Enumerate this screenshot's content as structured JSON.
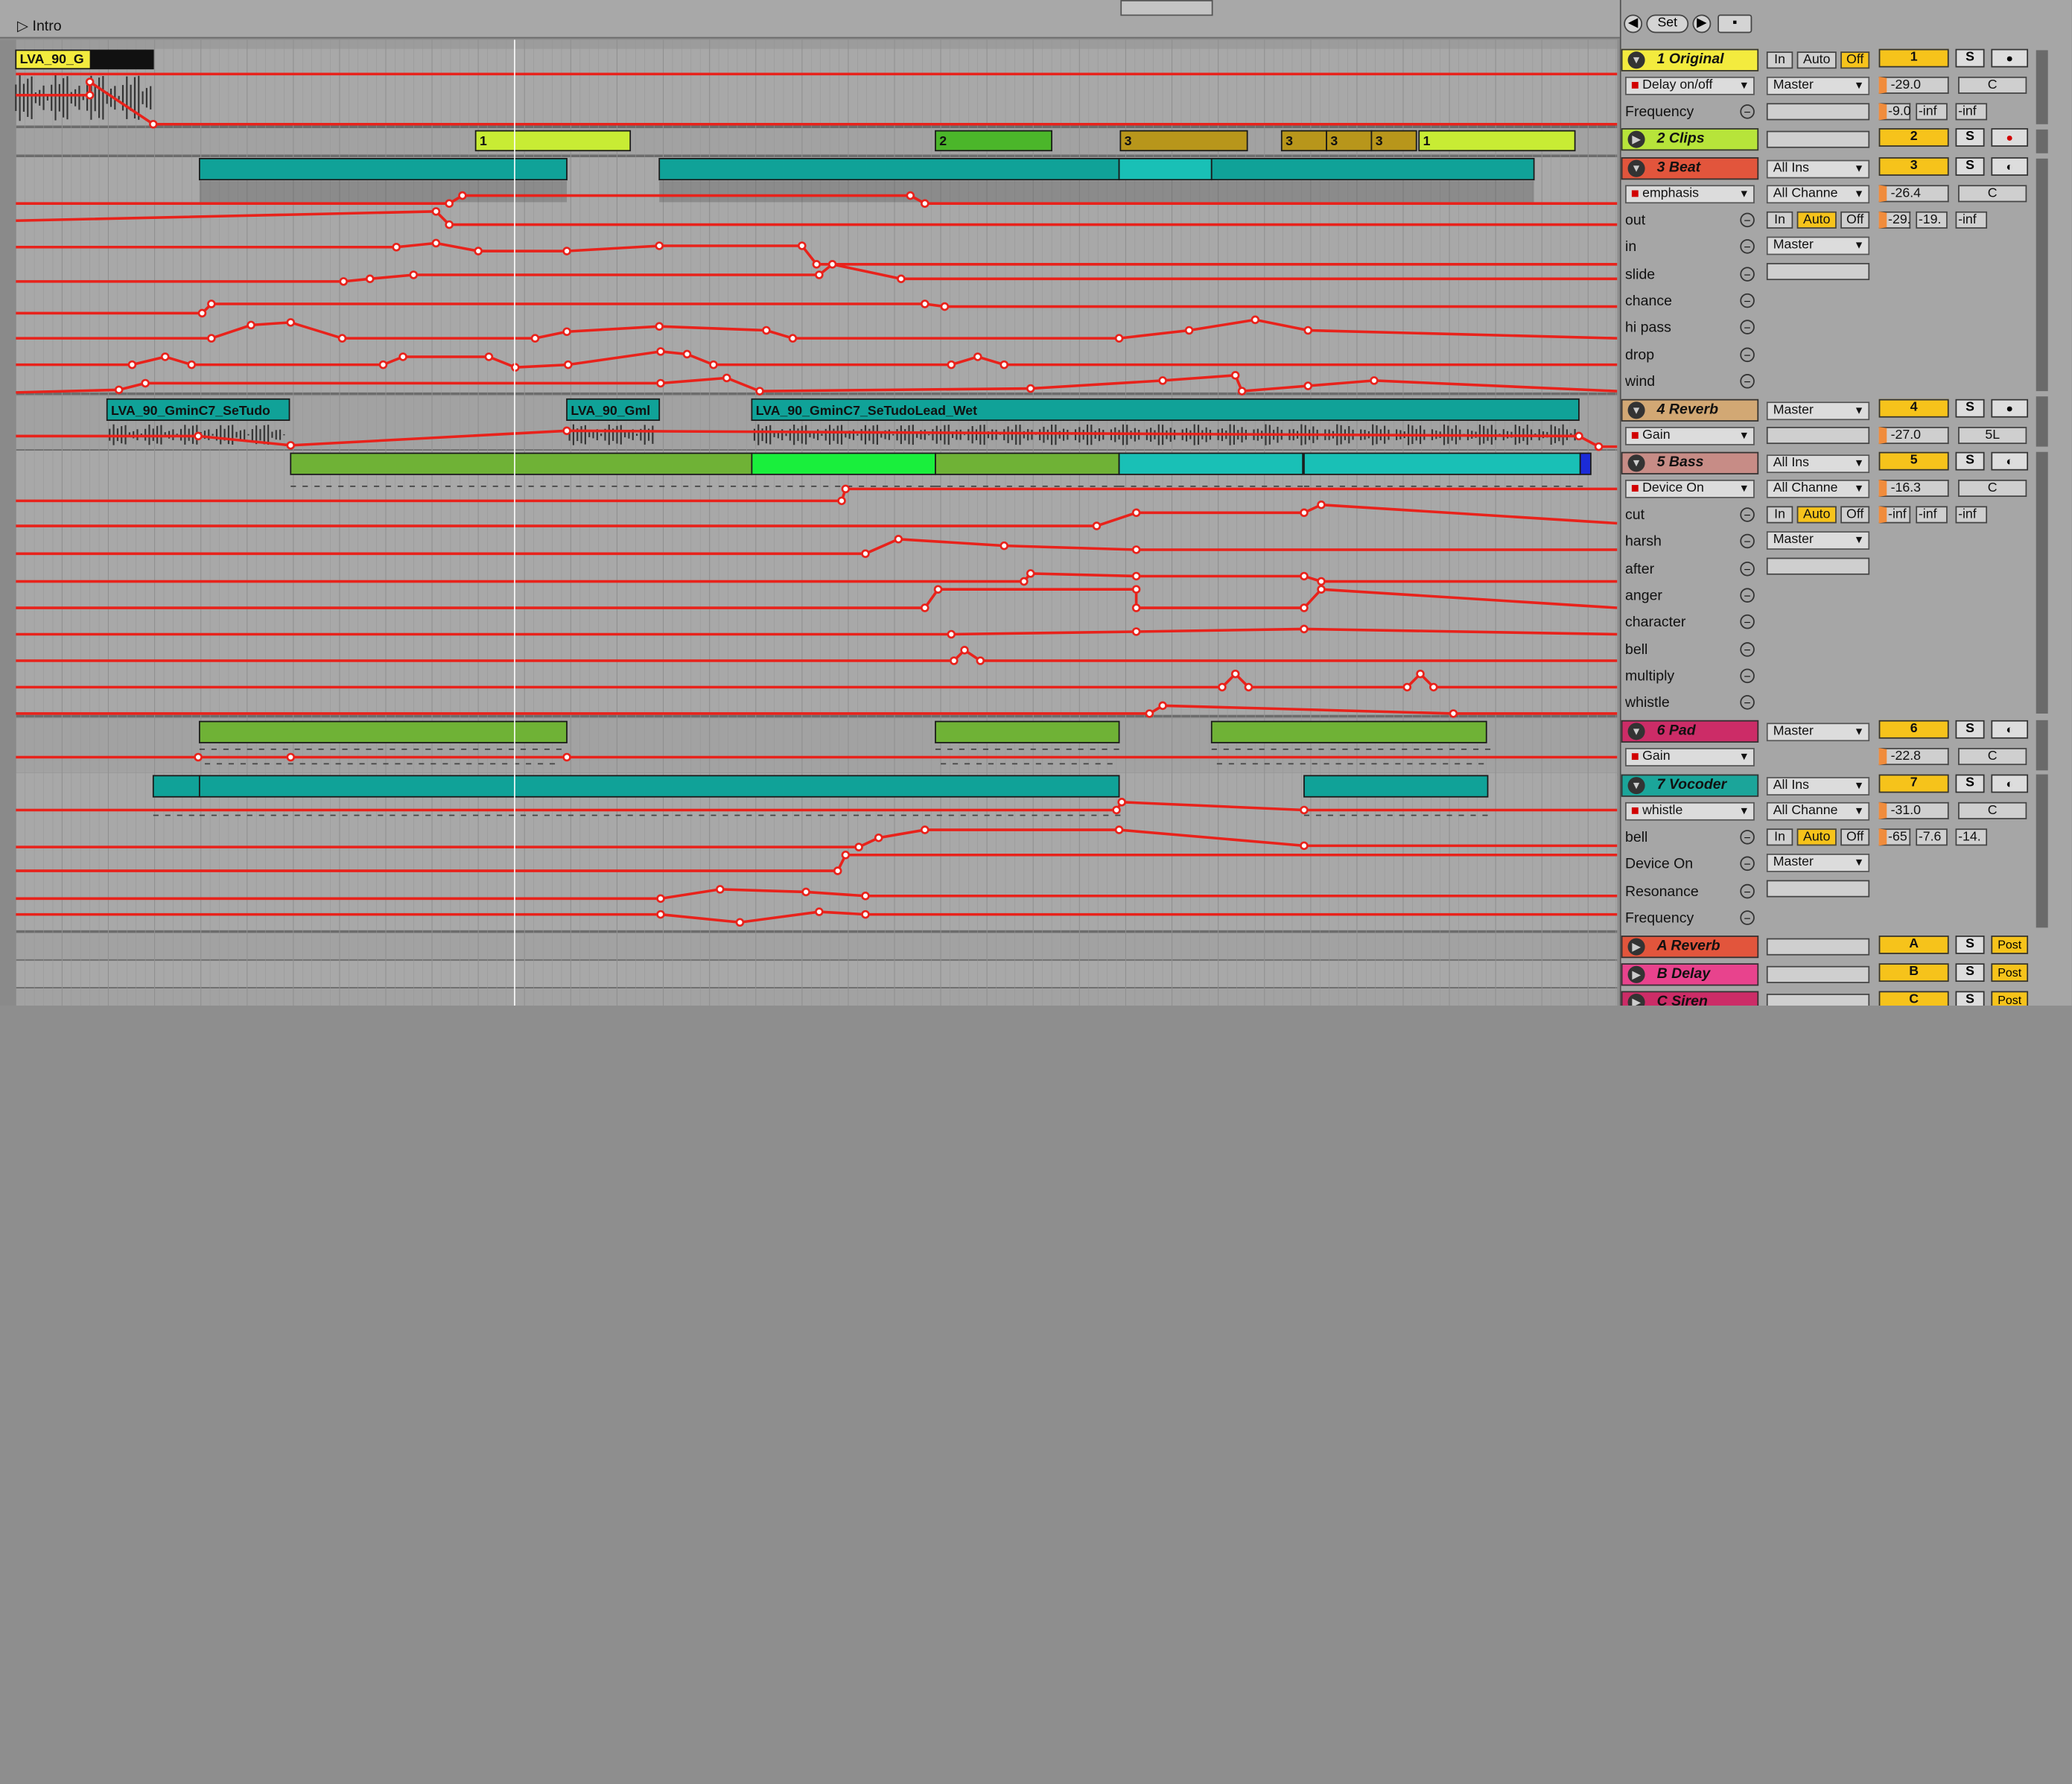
{
  "scene": {
    "name": "Intro"
  },
  "top_controls": {
    "back": "◀",
    "set": "Set",
    "forward": "▶"
  },
  "tracks": [
    {
      "num": "1",
      "name": "Original",
      "color": "#f3eb3e",
      "icon": "▼",
      "device": "Delay on/off",
      "param": "Frequency",
      "input": "In",
      "auto": "Auto",
      "off": "Off",
      "route": "Master",
      "vol": "-29.0",
      "pan": "C",
      "v2": "-9.0",
      "v3": "-inf",
      "v4": "-inf",
      "clip": "LVA_90_G"
    },
    {
      "num": "2",
      "name": "Clips",
      "color": "#b7e43a",
      "icon": "▶",
      "clips": [
        "1",
        "2",
        "3",
        "3",
        "3",
        "3",
        "1"
      ]
    },
    {
      "num": "3",
      "name": "Beat",
      "color": "#e2553c",
      "icon": "▼",
      "device": "emphasis",
      "route_in": "All Ins",
      "chan": "All Channe",
      "vol": "-26.4",
      "pan": "C",
      "input": "In",
      "auto": "Auto",
      "off": "Off",
      "v2": "-29.",
      "v3": "-19.",
      "v4": "-inf",
      "route": "Master",
      "params": [
        "out",
        "in",
        "slide",
        "chance",
        "hi pass",
        "drop",
        "wind"
      ]
    },
    {
      "num": "4",
      "name": "Reverb",
      "color": "#d2a874",
      "icon": "▼",
      "device": "Gain",
      "route": "Master",
      "vol": "-27.0",
      "pan": "5L",
      "clips": [
        "LVA_90_GminC7_SeTudo",
        "LVA_90_Gml",
        "LVA_90_GminC7_SeTudoLead_Wet"
      ]
    },
    {
      "num": "5",
      "name": "Bass",
      "color": "#c78c86",
      "icon": "▼",
      "device": "Device On",
      "route_in": "All Ins",
      "chan": "All Channe",
      "vol": "-16.3",
      "pan": "C",
      "input": "In",
      "auto": "Auto",
      "off": "Off",
      "v2": "-inf",
      "v3": "-inf",
      "v4": "-inf",
      "route": "Master",
      "params": [
        "cut",
        "harsh",
        "after",
        "anger",
        "character",
        "bell",
        "multiply",
        "whistle"
      ]
    },
    {
      "num": "6",
      "name": "Pad",
      "color": "#cc2c67",
      "icon": "▼",
      "device": "Gain",
      "route": "Master",
      "vol": "-22.8",
      "pan": "C"
    },
    {
      "num": "7",
      "name": "Vocoder",
      "color": "#1ba59a",
      "icon": "▼",
      "device": "whistle",
      "route_in": "All Ins",
      "chan": "All Channe",
      "vol": "-31.0",
      "pan": "C",
      "input": "In",
      "auto": "Auto",
      "off": "Off",
      "v2": "-65",
      "v3": "-7.6",
      "v4": "-14.",
      "route": "Master",
      "params": [
        "bell",
        "Device On",
        "Resonance",
        "Frequency"
      ]
    }
  ],
  "returns": [
    {
      "letter": "A",
      "name": "A Reverb",
      "color": "#e2553c",
      "post": "Post"
    },
    {
      "letter": "B",
      "name": "B Delay",
      "color": "#e8438d",
      "post": "Post"
    },
    {
      "letter": "C",
      "name": "C Siren",
      "color": "#cc2c67",
      "post": "Post"
    }
  ],
  "solo": "S",
  "colors": {
    "auto_line": "#e8221b",
    "clip_teal": "#10a298",
    "clip_green": "#6fb236",
    "clip_gold": "#b8961b",
    "accent": "#f6c31b"
  }
}
